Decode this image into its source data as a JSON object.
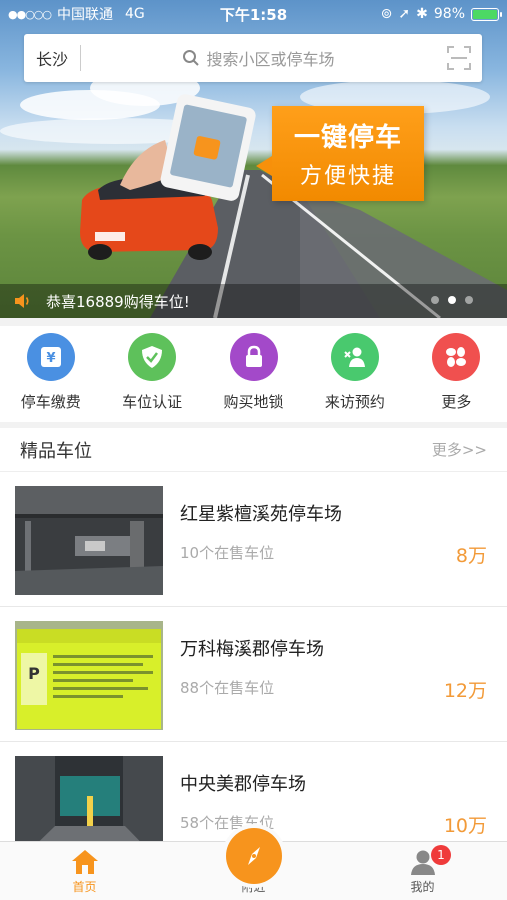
{
  "status_bar": {
    "carrier": "中国联通",
    "network": "4G",
    "time": "下午1:58",
    "battery": "98%",
    "battery_level": 0.98
  },
  "search": {
    "city": "长沙",
    "placeholder": "搜索小区或停车场"
  },
  "banner": {
    "promo_line1": "一键停车",
    "promo_line2": "方便快捷",
    "notice": "恭喜16889购得车位!",
    "page_count": 3,
    "active_page": 1
  },
  "actions": [
    {
      "label": "停车缴费",
      "icon": "yen-card-icon",
      "color": "#4a90e2"
    },
    {
      "label": "车位认证",
      "icon": "shield-check-icon",
      "color": "#5ec15b"
    },
    {
      "label": "购买地锁",
      "icon": "lock-icon",
      "color": "#a349c9"
    },
    {
      "label": "来访预约",
      "icon": "visitor-icon",
      "color": "#49c96e"
    },
    {
      "label": "更多",
      "icon": "more-grid-icon",
      "color": "#f0504f"
    }
  ],
  "section": {
    "title": "精品车位",
    "more": "更多>>"
  },
  "lots": [
    {
      "name": "红星紫檀溪苑停车场",
      "count": "10个在售车位",
      "price": "8万"
    },
    {
      "name": "万科梅溪郡停车场",
      "count": "88个在售车位",
      "price": "12万"
    },
    {
      "name": "中央美郡停车场",
      "count": "58个在售车位",
      "price": "10万"
    }
  ],
  "tabbar": {
    "home": "首页",
    "nearby": "附近",
    "mine": "我的",
    "mine_badge": "1"
  },
  "colors": {
    "accent": "#f7941d",
    "price": "#f29a38"
  }
}
